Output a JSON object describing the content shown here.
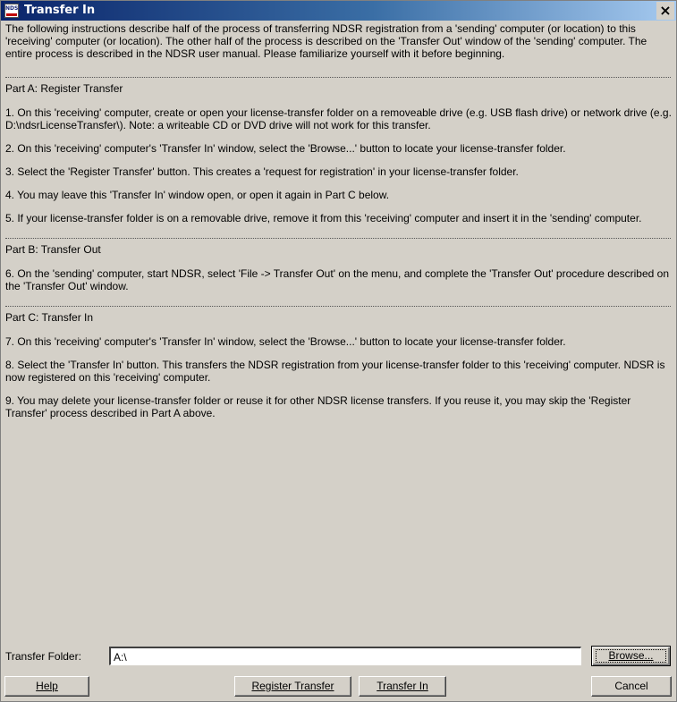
{
  "window": {
    "title": "Transfer In",
    "icon_text": "NDSK",
    "close_glyph": "×"
  },
  "content": {
    "intro": "The following instructions describe half of the process of transferring NDSR registration from a 'sending' computer (or location) to this 'receiving' computer (or location). The other half of the process is described on the 'Transfer Out' window of the 'sending' computer. The entire process is described in the NDSR user manual. Please familiarize yourself with it before beginning.",
    "part_a": {
      "heading": "Part A: Register Transfer",
      "steps": [
        "1. On this 'receiving' computer, create or open your license-transfer folder on a removeable drive (e.g. USB flash drive) or network drive (e.g. D:\\ndsrLicenseTransfer\\). Note: a writeable CD or DVD drive will not work for this transfer.",
        "2. On this 'receiving' computer's 'Transfer In' window, select the 'Browse...' button to locate your license-transfer folder.",
        "3. Select the 'Register Transfer' button. This creates a 'request for registration' in your license-transfer folder.",
        "4. You may leave this 'Transfer In' window open, or open it again in Part C below.",
        "5. If your license-transfer folder is on a removable drive, remove it from this 'receiving' computer and insert it in the 'sending' computer."
      ]
    },
    "part_b": {
      "heading": "Part B: Transfer Out",
      "steps": [
        "6. On the 'sending' computer, start NDSR, select 'File -> Transfer Out' on the menu, and complete the 'Transfer Out' procedure described on the 'Transfer Out' window."
      ]
    },
    "part_c": {
      "heading": "Part C: Transfer In",
      "steps": [
        "7. On this 'receiving' computer's 'Transfer In' window, select the 'Browse...' button to locate your license-transfer folder.",
        "8. Select the 'Transfer In' button. This transfers the NDSR registration from your license-transfer folder to this 'receiving' computer. NDSR is now registered on this 'receiving' computer.",
        "9. You may delete your license-transfer folder or reuse it for other NDSR license transfers. If you reuse it, you may skip the 'Register Transfer' process described in Part A above."
      ]
    }
  },
  "footer": {
    "folder_label": "Transfer Folder:",
    "folder_value": "A:\\",
    "browse_label": "Browse...",
    "help_label": "Help",
    "register_label": "Register Transfer",
    "transfer_in_label": "Transfer In",
    "cancel_label": "Cancel"
  },
  "colors": {
    "titlebar_start": "#0a246a",
    "titlebar_end": "#a6caf0",
    "dialog_face": "#d4d0c8"
  }
}
